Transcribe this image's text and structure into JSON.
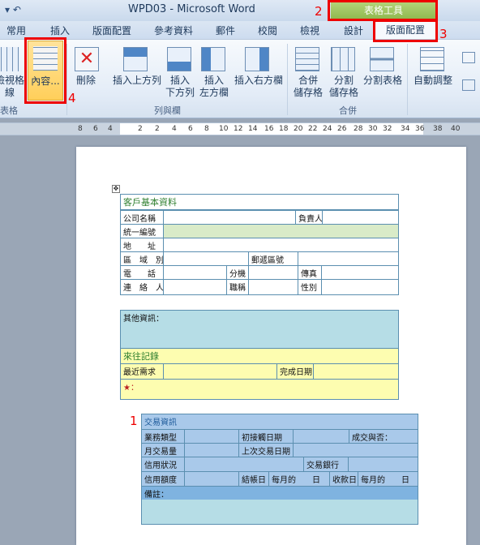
{
  "window": {
    "title": "WPD03  -  Microsoft Word",
    "contextual_tab": "表格工具"
  },
  "quick_access": {
    "save_icon": "save-icon",
    "undo_icon": "undo-icon"
  },
  "tabs": [
    "常用",
    "插入",
    "版面配置",
    "參考資料",
    "郵件",
    "校閱",
    "檢視",
    "設計",
    "版面配置"
  ],
  "ribbon": {
    "btn_gridlines": "檢視格線",
    "btn_properties": "內容...",
    "btn_delete": "刪除",
    "btn_insert_above": "插入上方列",
    "btn_insert_below_1": "插入",
    "btn_insert_below_2": "下方列",
    "btn_insert_left_1": "插入",
    "btn_insert_left_2": "左方欄",
    "btn_insert_right": "插入右方欄",
    "btn_merge_1": "合併",
    "btn_merge_2": "儲存格",
    "btn_split_1": "分割",
    "btn_split_2": "儲存格",
    "btn_split_table": "分割表格",
    "btn_autofit": "自動調整",
    "group_table": "表格",
    "group_rows_cols": "列與欄",
    "group_merge": "合併"
  },
  "ruler": [
    "8",
    "6",
    "4",
    "2",
    "2",
    "4",
    "6",
    "8",
    "10",
    "12",
    "14",
    "16",
    "18",
    "20",
    "22",
    "24",
    "26",
    "28",
    "30",
    "32",
    "34",
    "36",
    "38",
    "40"
  ],
  "callouts": [
    "1",
    "2",
    "3",
    "4"
  ],
  "table1": {
    "title": "客戶基本資料",
    "company": "公司名稱",
    "owner": "負責人",
    "tax_id": "統一編號",
    "address": "地　　址",
    "area": "區　域　別",
    "zip": "郵遞區號",
    "phone": "電　　話",
    "ext": "分機",
    "fax": "傳真",
    "contact": "連　絡　人",
    "job": "職稱",
    "gender": "性別"
  },
  "table2": {
    "other": "其他資訊：",
    "history": "來往記錄",
    "recent": "最近需求",
    "done_date": "完成日期",
    "sign": "★："
  },
  "table3": {
    "title": "交易資訊",
    "biz_type": "業務類型",
    "first_date": "初接觸日期",
    "deal": "成交與否：",
    "month_amt": "月交易量",
    "last_date": "上次交易日期",
    "credit": "信用狀況",
    "bank": "交易銀行",
    "limit": "信用額度",
    "bill_day": "結帳日",
    "bill_val": "每月的　　日",
    "collect_day": "收款日",
    "collect_val": "每月的　　日",
    "note": "備註："
  }
}
